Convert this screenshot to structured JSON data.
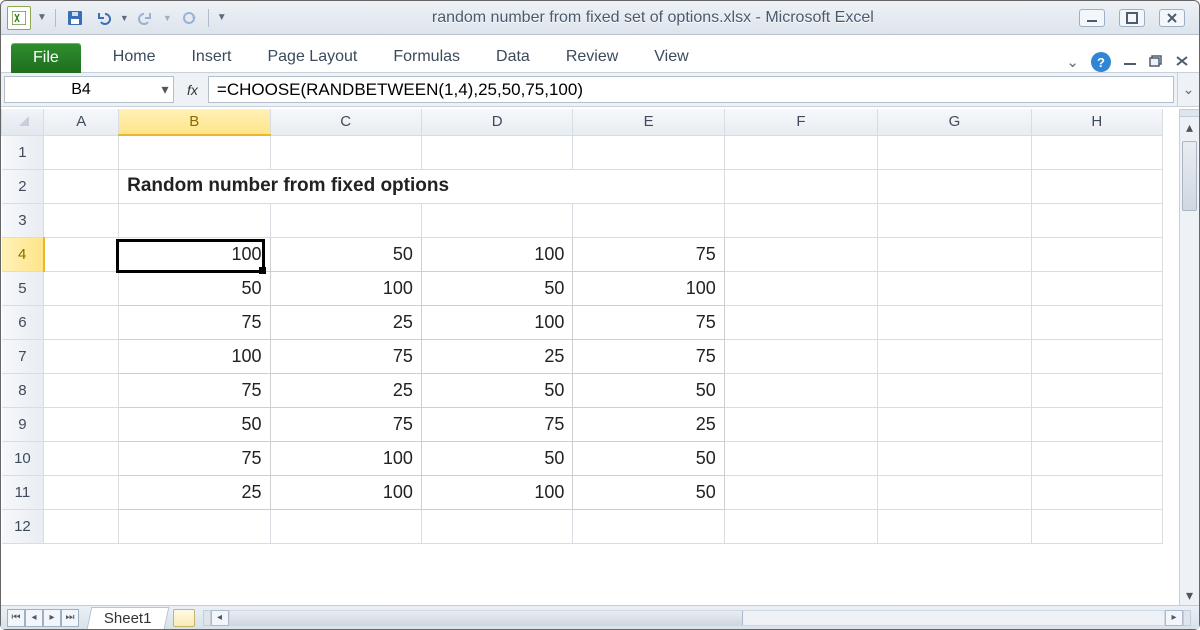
{
  "window": {
    "title": "random number from fixed set of options.xlsx  -  Microsoft Excel"
  },
  "ribbon": {
    "file": "File",
    "tabs": [
      "Home",
      "Insert",
      "Page Layout",
      "Formulas",
      "Data",
      "Review",
      "View"
    ]
  },
  "namebox": {
    "ref": "B4"
  },
  "formula": {
    "fx": "fx",
    "value": "=CHOOSE(RANDBETWEEN(1,4),25,50,75,100)"
  },
  "columns": [
    "A",
    "B",
    "C",
    "D",
    "E",
    "F",
    "G",
    "H"
  ],
  "row_numbers": [
    "1",
    "2",
    "3",
    "4",
    "5",
    "6",
    "7",
    "8",
    "9",
    "10",
    "11",
    "12"
  ],
  "heading": "Random number from fixed options",
  "active_cell": {
    "col": "B",
    "row": 4
  },
  "chart_data": {
    "type": "table",
    "title": "Random number from fixed options",
    "columns": [
      "B",
      "C",
      "D",
      "E"
    ],
    "rows_index": [
      4,
      5,
      6,
      7,
      8,
      9,
      10,
      11
    ],
    "values": [
      [
        100,
        50,
        100,
        75
      ],
      [
        50,
        100,
        50,
        100
      ],
      [
        75,
        25,
        100,
        75
      ],
      [
        100,
        75,
        25,
        75
      ],
      [
        75,
        25,
        50,
        50
      ],
      [
        50,
        75,
        75,
        25
      ],
      [
        75,
        100,
        50,
        50
      ],
      [
        25,
        100,
        100,
        50
      ]
    ]
  },
  "sheettab": "Sheet1"
}
